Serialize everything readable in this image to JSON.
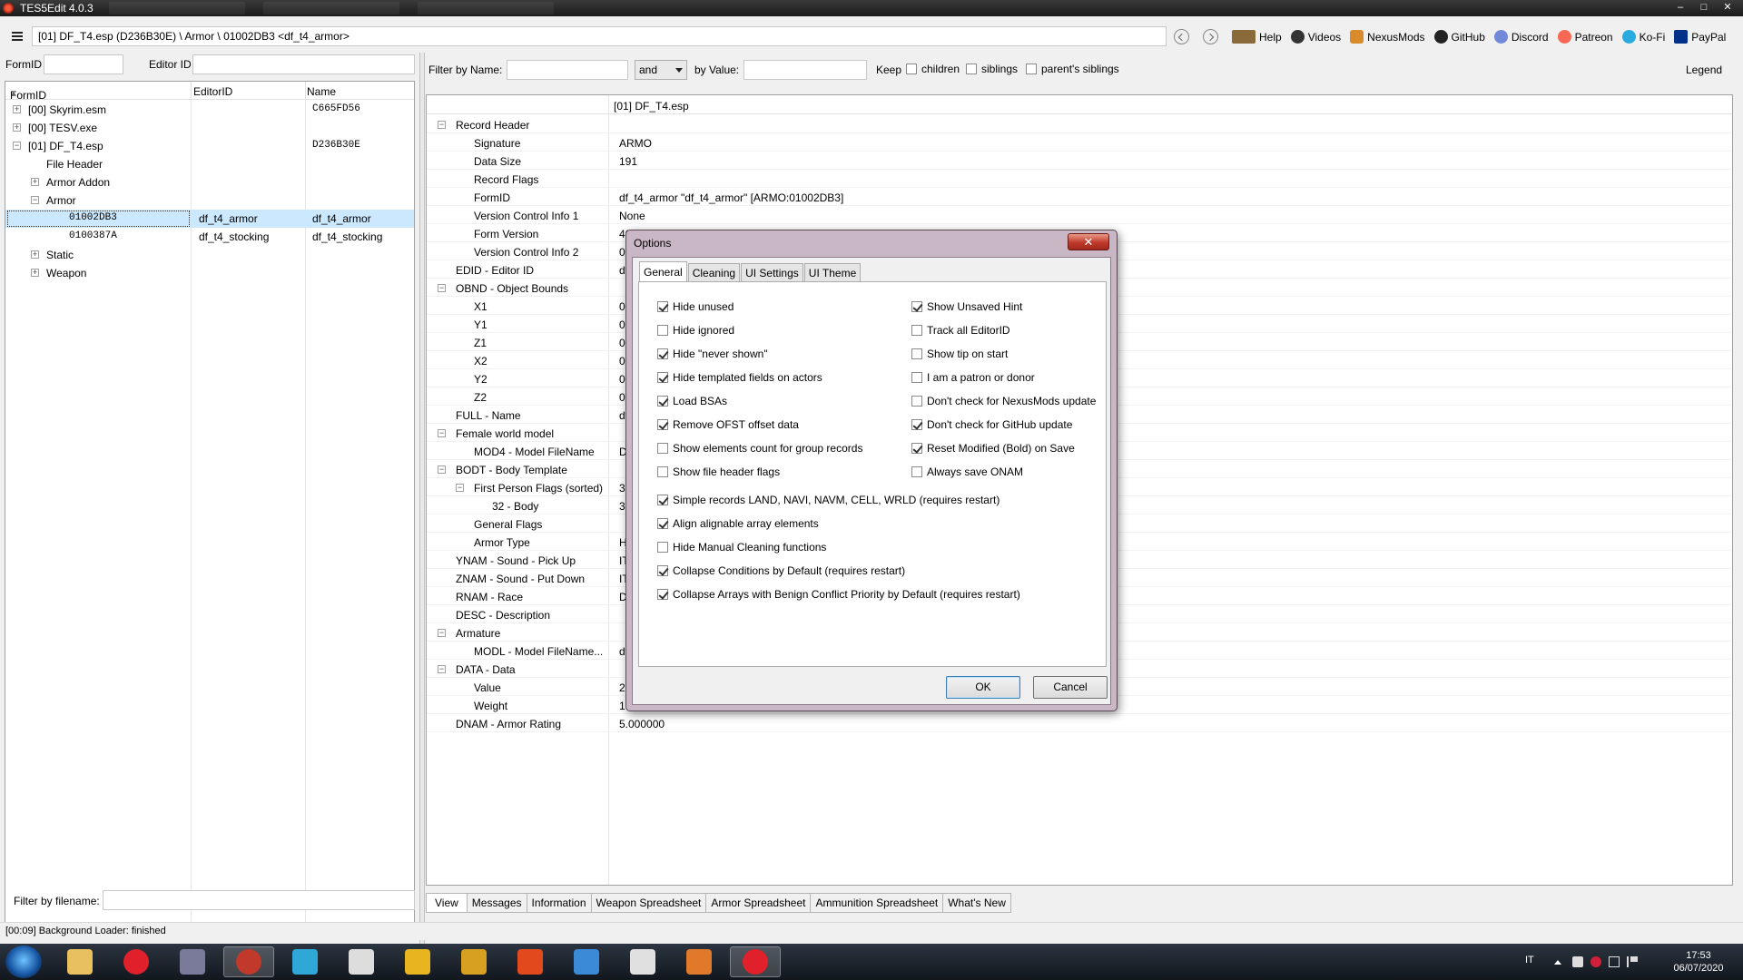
{
  "window": {
    "title": "TES5Edit 4.0.3",
    "controls": [
      "–",
      "□",
      "✕"
    ]
  },
  "path": {
    "value": "[01] DF_T4.esp (D236B30E) \\ Armor \\ 01002DB3 <df_t4_armor>"
  },
  "toplinks": [
    {
      "label": "Help",
      "icon": "book-icon",
      "color": "#7a5a30"
    },
    {
      "label": "Videos",
      "icon": "video-icon",
      "color": "#333333"
    },
    {
      "label": "NexusMods",
      "icon": "nexusmods-icon",
      "color": "#d98a2b"
    },
    {
      "label": "GitHub",
      "icon": "github-icon",
      "color": "#222222"
    },
    {
      "label": "Discord",
      "icon": "discord-icon",
      "color": "#7289da"
    },
    {
      "label": "Patreon",
      "icon": "patreon-icon",
      "color": "#f96854"
    },
    {
      "label": "Ko-Fi",
      "icon": "kofi-icon",
      "color": "#29abe0"
    },
    {
      "label": "PayPal",
      "icon": "paypal-icon",
      "color": "#003087"
    }
  ],
  "left": {
    "formid_label": "FormID",
    "editorid_label": "Editor ID",
    "columns": [
      "FormID",
      "EditorID",
      "Name"
    ],
    "rows": [
      {
        "id": "[00] Skyrim.esm",
        "editor": "",
        "name": "C665FD56",
        "indent": 0,
        "exp": "+"
      },
      {
        "id": "[00] TESV.exe",
        "editor": "",
        "name": "",
        "indent": 0,
        "exp": "+"
      },
      {
        "id": "[01] DF_T4.esp",
        "editor": "",
        "name": "D236B30E",
        "indent": 0,
        "exp": "−"
      },
      {
        "id": "File Header",
        "editor": "",
        "name": "",
        "indent": 1,
        "exp": ""
      },
      {
        "id": "Armor Addon",
        "editor": "",
        "name": "",
        "indent": 1,
        "exp": "+"
      },
      {
        "id": "Armor",
        "editor": "",
        "name": "",
        "indent": 1,
        "exp": "−"
      },
      {
        "id": "01002DB3",
        "editor": "df_t4_armor",
        "name": "df_t4_armor",
        "indent": 2,
        "exp": ""
      },
      {
        "id": "0100387A",
        "editor": "df_t4_stocking",
        "name": "df_t4_stocking",
        "indent": 2,
        "exp": ""
      },
      {
        "id": "Static",
        "editor": "",
        "name": "",
        "indent": 1,
        "exp": "+"
      },
      {
        "id": "Weapon",
        "editor": "",
        "name": "",
        "indent": 1,
        "exp": "+"
      }
    ],
    "filename_filter_label": "Filter by filename:"
  },
  "right": {
    "filter_name_label": "Filter by Name:",
    "and_select": "and",
    "filter_value_label": "by Value:",
    "keep_label": "Keep",
    "children_label": "children",
    "siblings_label": "siblings",
    "parents_siblings_label": "parent's siblings",
    "legend_label": "Legend",
    "column_header": "[01] DF_T4.esp",
    "rows": [
      {
        "k": "Record Header",
        "v": "",
        "indent": 0,
        "exp": "−"
      },
      {
        "k": "Signature",
        "v": "ARMO",
        "indent": 1,
        "exp": ""
      },
      {
        "k": "Data Size",
        "v": "191",
        "indent": 1,
        "exp": ""
      },
      {
        "k": "Record Flags",
        "v": "",
        "indent": 1,
        "exp": ""
      },
      {
        "k": "FormID",
        "v": "df_t4_armor \"df_t4_armor\" [ARMO:01002DB3]",
        "indent": 1,
        "exp": ""
      },
      {
        "k": "Version Control Info 1",
        "v": "None",
        "indent": 1,
        "exp": ""
      },
      {
        "k": "Form Version",
        "v": "40",
        "indent": 1,
        "exp": ""
      },
      {
        "k": "Version Control Info 2",
        "v": "0",
        "indent": 1,
        "exp": ""
      },
      {
        "k": "EDID - Editor ID",
        "v": "df",
        "indent": 0,
        "exp": ""
      },
      {
        "k": "OBND - Object Bounds",
        "v": "",
        "indent": 0,
        "exp": "−"
      },
      {
        "k": "X1",
        "v": "0",
        "indent": 1,
        "exp": ""
      },
      {
        "k": "Y1",
        "v": "0",
        "indent": 1,
        "exp": ""
      },
      {
        "k": "Z1",
        "v": "0",
        "indent": 1,
        "exp": ""
      },
      {
        "k": "X2",
        "v": "0",
        "indent": 1,
        "exp": ""
      },
      {
        "k": "Y2",
        "v": "0",
        "indent": 1,
        "exp": ""
      },
      {
        "k": "Z2",
        "v": "0",
        "indent": 1,
        "exp": ""
      },
      {
        "k": "FULL - Name",
        "v": "df",
        "indent": 0,
        "exp": ""
      },
      {
        "k": "Female world model",
        "v": "",
        "indent": 0,
        "exp": "−"
      },
      {
        "k": "MOD4 - Model FileName",
        "v": "D",
        "indent": 1,
        "exp": ""
      },
      {
        "k": "BODT - Body Template",
        "v": "",
        "indent": 0,
        "exp": "−"
      },
      {
        "k": "First Person Flags (sorted)",
        "v": "3",
        "indent": 1,
        "exp": "−"
      },
      {
        "k": "32 - Body",
        "v": "3",
        "indent": 2,
        "exp": ""
      },
      {
        "k": "General Flags",
        "v": "",
        "indent": 1,
        "exp": ""
      },
      {
        "k": "Armor Type",
        "v": "H",
        "indent": 1,
        "exp": ""
      },
      {
        "k": "YNAM - Sound - Pick Up",
        "v": "IT",
        "indent": 0,
        "exp": ""
      },
      {
        "k": "ZNAM - Sound - Put Down",
        "v": "IT",
        "indent": 0,
        "exp": ""
      },
      {
        "k": "RNAM - Race",
        "v": "D",
        "indent": 0,
        "exp": ""
      },
      {
        "k": "DESC - Description",
        "v": "",
        "indent": 0,
        "exp": ""
      },
      {
        "k": "Armature",
        "v": "",
        "indent": 0,
        "exp": "−"
      },
      {
        "k": "MODL - Model FileName...",
        "v": "df",
        "indent": 1,
        "exp": ""
      },
      {
        "k": "DATA - Data",
        "v": "",
        "indent": 0,
        "exp": "−"
      },
      {
        "k": "Value",
        "v": "2",
        "indent": 1,
        "exp": ""
      },
      {
        "k": "Weight",
        "v": "1",
        "indent": 1,
        "exp": ""
      },
      {
        "k": "DNAM - Armor Rating",
        "v": "5.000000",
        "indent": 0,
        "exp": ""
      }
    ],
    "bottom_tabs": [
      "View",
      "Messages",
      "Information",
      "Weapon Spreadsheet",
      "Armor Spreadsheet",
      "Ammunition Spreadsheet",
      "What's New"
    ]
  },
  "status": "[00:09] Background Loader: finished",
  "dialog": {
    "title": "Options",
    "close": "✕",
    "tabs": [
      "General",
      "Cleaning",
      "UI Settings",
      "UI Theme"
    ],
    "left_options": [
      {
        "label": "Hide unused",
        "checked": true
      },
      {
        "label": "Hide ignored",
        "checked": false
      },
      {
        "label": "Hide \"never shown\"",
        "checked": true
      },
      {
        "label": "Hide templated fields on actors",
        "checked": true
      },
      {
        "label": "Load BSAs",
        "checked": true
      },
      {
        "label": "Remove OFST offset data",
        "checked": true
      },
      {
        "label": "Show elements count for group records",
        "checked": false
      },
      {
        "label": "Show file header flags",
        "checked": false
      }
    ],
    "right_options": [
      {
        "label": "Show Unsaved Hint",
        "checked": true
      },
      {
        "label": "Track all EditorID",
        "checked": false
      },
      {
        "label": "Show tip on start",
        "checked": false
      },
      {
        "label": "I am a patron or donor",
        "checked": false
      },
      {
        "label": "Don't check for NexusMods update",
        "checked": false
      },
      {
        "label": "Don't check for GitHub update",
        "checked": true
      },
      {
        "label": "Reset Modified (Bold) on Save",
        "checked": true
      },
      {
        "label": "Always save ONAM",
        "checked": false
      }
    ],
    "full_options": [
      {
        "label": "Simple records LAND, NAVI, NAVM, CELL, WRLD (requires restart)",
        "checked": true
      },
      {
        "label": "Align alignable array elements",
        "checked": true
      },
      {
        "label": "Hide Manual Cleaning functions",
        "checked": false
      },
      {
        "label": "Collapse Conditions by Default (requires restart)",
        "checked": true
      },
      {
        "label": "Collapse Arrays with Benign Conflict Priority by Default (requires restart)",
        "checked": true
      }
    ],
    "ok": "OK",
    "cancel": "Cancel"
  },
  "taskbar": {
    "apps": [
      {
        "name": "explorer-icon",
        "color": "#e8c060"
      },
      {
        "name": "opera-icon",
        "color": "#e0202a"
      },
      {
        "name": "app-film-icon",
        "color": "#7a7a9a"
      },
      {
        "name": "tes5edit-icon",
        "color": "#c0392b"
      },
      {
        "name": "music-icon",
        "color": "#2fa8d8"
      },
      {
        "name": "pipe-icon",
        "color": "#dddddd"
      },
      {
        "name": "folder-app-icon",
        "color": "#e8b420"
      },
      {
        "name": "arrow-app-icon",
        "color": "#d8a020"
      },
      {
        "name": "f-app-icon",
        "color": "#e24a1e"
      },
      {
        "name": "ff-app-icon",
        "color": "#3a8ad8"
      },
      {
        "name": "window-app-icon",
        "color": "#e0e0e0"
      },
      {
        "name": "x-app-icon",
        "color": "#e07a2a"
      },
      {
        "name": "opera-gx-icon",
        "color": "#e0202a"
      }
    ],
    "lang": "IT",
    "time": "17:53",
    "date": "06/07/2020"
  }
}
